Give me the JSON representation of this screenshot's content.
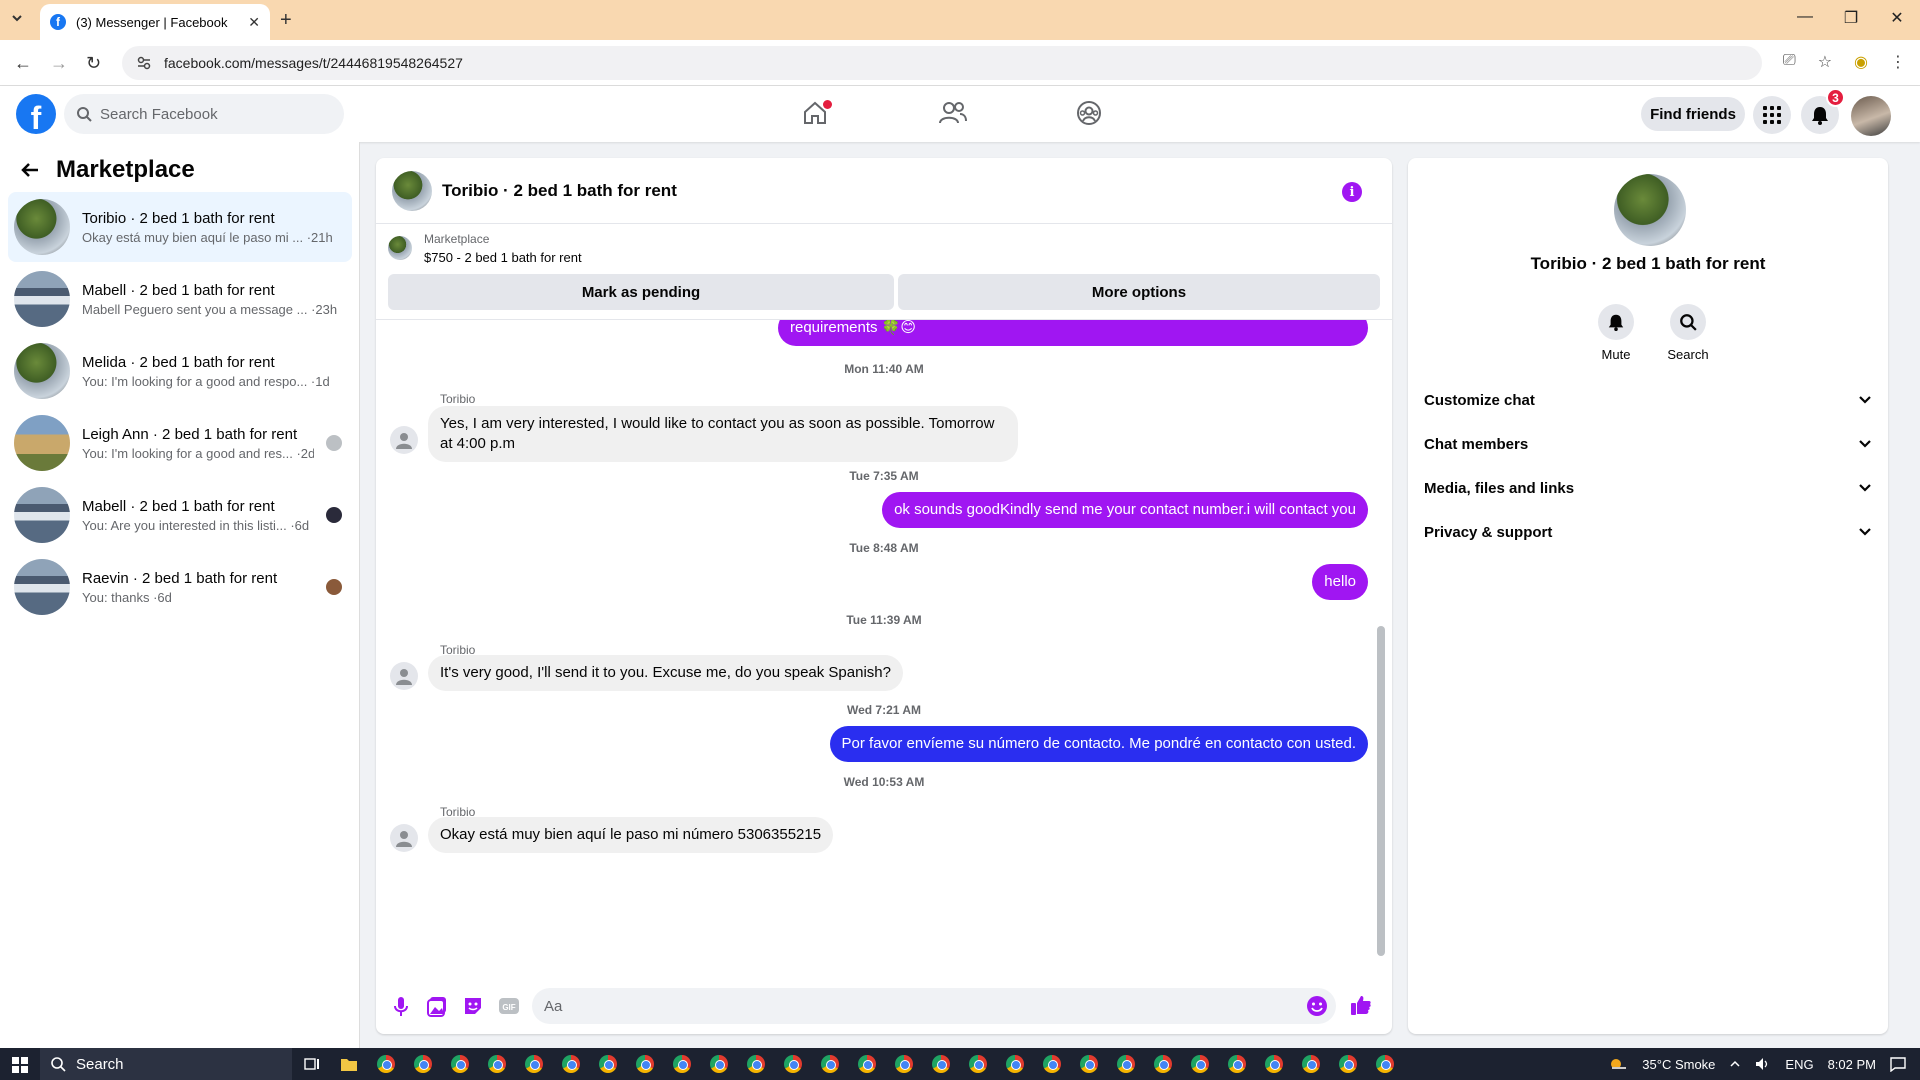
{
  "browser": {
    "tab_title": "(3) Messenger | Facebook",
    "url": "facebook.com/messages/t/24446819548264527"
  },
  "header": {
    "search_placeholder": "Search Facebook",
    "find_friends": "Find friends",
    "notifications_count": "3"
  },
  "sidebar": {
    "title": "Marketplace",
    "conversations": [
      {
        "name": "Toribio · 2 bed 1 bath for rent",
        "snippet": "Okay está muy bien aquí le paso mi ... ·21h",
        "avatar": "tree",
        "active": true
      },
      {
        "name": "Mabell · 2 bed 1 bath for rent",
        "snippet": "Mabell Peguero sent you a message ... ·23h",
        "avatar": "house"
      },
      {
        "name": "Melida · 2 bed 1 bath for rent",
        "snippet": "You: I'm looking for a good and respo... ·1d",
        "avatar": "tree"
      },
      {
        "name": "Leigh Ann · 2 bed 1 bath for rent",
        "snippet": "You: I'm looking for a good and res... ·2d",
        "avatar": "house2"
      },
      {
        "name": "Mabell · 2 bed 1 bath for rent",
        "snippet": "You: Are you interested in this listi... ·6d",
        "avatar": "house"
      },
      {
        "name": "Raevin · 2 bed 1 bath for rent",
        "snippet": "You: thanks ·6d",
        "avatar": "house"
      }
    ]
  },
  "chat": {
    "title": "Toribio · 2 bed 1 bath for rent",
    "marketplace_label": "Marketplace",
    "listing": "$750 - 2 bed 1 bath for rent",
    "mark_pending": "Mark as pending",
    "more_options": "More options",
    "partial_message": "requirements 🍀😊",
    "messages": [
      {
        "type": "timestamp",
        "text": "Mon 11:40 AM"
      },
      {
        "type": "in",
        "sender": "Toribio",
        "text": "Yes, I am very interested, I would like to contact you as soon as possible. Tomorrow at 4:00 p.m"
      },
      {
        "type": "timestamp",
        "text": "Tue 7:35 AM"
      },
      {
        "type": "out",
        "text": "ok sounds goodKindly send me your contact number.i will contact you"
      },
      {
        "type": "timestamp",
        "text": "Tue 8:48 AM"
      },
      {
        "type": "out",
        "text": "hello"
      },
      {
        "type": "timestamp",
        "text": "Tue 11:39 AM"
      },
      {
        "type": "in",
        "sender": "Toribio",
        "text": "It's very good, I'll send it to you. Excuse me, do you speak Spanish?"
      },
      {
        "type": "timestamp",
        "text": "Wed 7:21 AM"
      },
      {
        "type": "out",
        "text": "Por favor envíeme su número de contacto. Me pondré en contacto con usted."
      },
      {
        "type": "timestamp",
        "text": "Wed 10:53 AM"
      },
      {
        "type": "in",
        "sender": "Toribio",
        "text": "Okay está muy bien aquí le paso mi número 5306355215"
      }
    ],
    "input_placeholder": "Aa",
    "accent_color": "#a016f2"
  },
  "right_panel": {
    "name": "Toribio · 2 bed 1 bath for rent",
    "mute": "Mute",
    "search": "Search",
    "sections": [
      "Customize chat",
      "Chat members",
      "Media, files and links",
      "Privacy & support"
    ]
  },
  "taskbar": {
    "search": "Search",
    "weather": "35°C  Smoke",
    "lang": "ENG",
    "time": "8:02 PM"
  }
}
